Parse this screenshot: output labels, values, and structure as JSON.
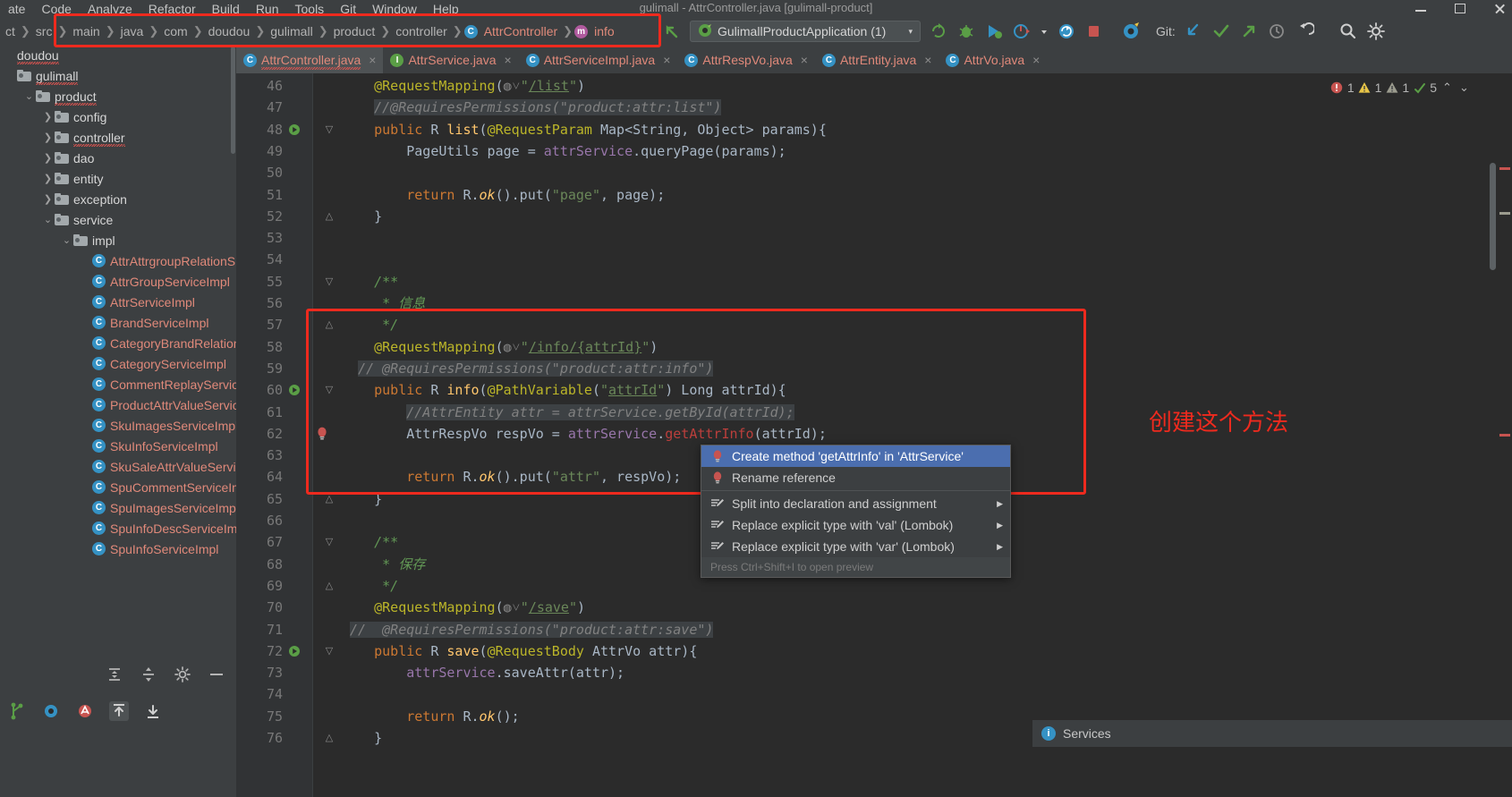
{
  "window": {
    "title": "gulimall - AttrController.java [gulimall-product]",
    "minimize_label": "minimize",
    "maximize_label": "maximize",
    "close_label": "close"
  },
  "menubar": {
    "items": [
      "ate",
      "Code",
      "Analyze",
      "Refactor",
      "Build",
      "Run",
      "Tools",
      "Git",
      "Window",
      "Help"
    ]
  },
  "navbar": {
    "crumbs": [
      {
        "label": "ct",
        "icon": null
      },
      {
        "label": "src",
        "icon": null
      },
      {
        "label": "main",
        "icon": null
      },
      {
        "label": "java",
        "icon": null
      },
      {
        "label": "com",
        "icon": null
      },
      {
        "label": "doudou",
        "icon": null
      },
      {
        "label": "gulimall",
        "icon": null
      },
      {
        "label": "product",
        "icon": null
      },
      {
        "label": "controller",
        "icon": null
      },
      {
        "label": "AttrController",
        "icon": "class-icon"
      },
      {
        "label": "info",
        "icon": "method-icon"
      }
    ]
  },
  "toolbar": {
    "back_icon": "back-arrow-icon",
    "run_config": "GulimallProductApplication (1)",
    "run_config_icon": "spring-boot-icon",
    "dropdown_arrow": "▾",
    "buttons": [
      {
        "name": "rerun-icon",
        "glyph": "⟳"
      },
      {
        "name": "debug-icon",
        "glyph": "🐞"
      },
      {
        "name": "run-with-coverage-icon",
        "glyph": "▶"
      },
      {
        "name": "profiler-icon",
        "glyph": "◔"
      },
      {
        "name": "profiler-dropdown-icon",
        "glyph": "▾"
      },
      {
        "name": "update-app-icon",
        "glyph": "↻"
      },
      {
        "name": "stop-icon",
        "glyph": "■"
      },
      {
        "name": "spring-icon",
        "glyph": "❧"
      }
    ],
    "git_label": "Git:",
    "git_buttons": [
      {
        "name": "git-update-project-icon",
        "glyph": "↙"
      },
      {
        "name": "git-commit-icon",
        "glyph": "✓"
      },
      {
        "name": "git-push-icon",
        "glyph": "↗"
      },
      {
        "name": "git-history-icon",
        "glyph": "◷"
      },
      {
        "name": "git-rollback-icon",
        "glyph": "↺"
      }
    ],
    "extra_buttons": [
      {
        "name": "search-everywhere-icon",
        "glyph": "⌕"
      },
      {
        "name": "settings-icon",
        "glyph": "⚙"
      }
    ]
  },
  "sidebar": {
    "toolbar_icons": [
      "locate-icon",
      "expand-all-icon",
      "collapse-all-icon",
      "settings-icon",
      "hide-icon"
    ],
    "tree": [
      {
        "label": "doudou",
        "indent": 0,
        "twisty": "",
        "icon": "none",
        "squiggle": true,
        "red": false
      },
      {
        "label": "gulimall",
        "indent": 0,
        "twisty": "",
        "icon": "folder",
        "squiggle": true,
        "red": false
      },
      {
        "label": "product",
        "indent": 1,
        "twisty": "v",
        "icon": "folder",
        "squiggle": true,
        "red": false
      },
      {
        "label": "config",
        "indent": 2,
        "twisty": ">",
        "icon": "folder",
        "squiggle": false,
        "red": false
      },
      {
        "label": "controller",
        "indent": 2,
        "twisty": ">",
        "icon": "folder",
        "squiggle": true,
        "red": false
      },
      {
        "label": "dao",
        "indent": 2,
        "twisty": ">",
        "icon": "folder",
        "squiggle": false,
        "red": false
      },
      {
        "label": "entity",
        "indent": 2,
        "twisty": ">",
        "icon": "folder",
        "squiggle": false,
        "red": false
      },
      {
        "label": "exception",
        "indent": 2,
        "twisty": ">",
        "icon": "folder",
        "squiggle": false,
        "red": false
      },
      {
        "label": "service",
        "indent": 2,
        "twisty": "v",
        "icon": "folder",
        "squiggle": false,
        "red": false
      },
      {
        "label": "impl",
        "indent": 3,
        "twisty": "v",
        "icon": "folder",
        "squiggle": false,
        "red": false
      },
      {
        "label": "AttrAttrgroupRelationS",
        "indent": 4,
        "twisty": "",
        "icon": "class",
        "squiggle": false,
        "red": true
      },
      {
        "label": "AttrGroupServiceImpl",
        "indent": 4,
        "twisty": "",
        "icon": "class",
        "squiggle": false,
        "red": true
      },
      {
        "label": "AttrServiceImpl",
        "indent": 4,
        "twisty": "",
        "icon": "class",
        "squiggle": false,
        "red": true
      },
      {
        "label": "BrandServiceImpl",
        "indent": 4,
        "twisty": "",
        "icon": "class",
        "squiggle": false,
        "red": true
      },
      {
        "label": "CategoryBrandRelations",
        "indent": 4,
        "twisty": "",
        "icon": "class",
        "squiggle": false,
        "red": true
      },
      {
        "label": "CategoryServiceImpl",
        "indent": 4,
        "twisty": "",
        "icon": "class",
        "squiggle": false,
        "red": true
      },
      {
        "label": "CommentReplayService",
        "indent": 4,
        "twisty": "",
        "icon": "class",
        "squiggle": false,
        "red": true
      },
      {
        "label": "ProductAttrValueServic",
        "indent": 4,
        "twisty": "",
        "icon": "class",
        "squiggle": false,
        "red": true
      },
      {
        "label": "SkuImagesServiceImpl",
        "indent": 4,
        "twisty": "",
        "icon": "class",
        "squiggle": false,
        "red": true
      },
      {
        "label": "SkuInfoServiceImpl",
        "indent": 4,
        "twisty": "",
        "icon": "class",
        "squiggle": false,
        "red": true
      },
      {
        "label": "SkuSaleAttrValueService",
        "indent": 4,
        "twisty": "",
        "icon": "class",
        "squiggle": false,
        "red": true
      },
      {
        "label": "SpuCommentServiceIm",
        "indent": 4,
        "twisty": "",
        "icon": "class",
        "squiggle": false,
        "red": true
      },
      {
        "label": "SpuImagesServiceImpl",
        "indent": 4,
        "twisty": "",
        "icon": "class",
        "squiggle": false,
        "red": true
      },
      {
        "label": "SpuInfoDescServiceImp",
        "indent": 4,
        "twisty": "",
        "icon": "class",
        "squiggle": false,
        "red": true
      },
      {
        "label": "SpuInfoServiceImpl",
        "indent": 4,
        "twisty": "",
        "icon": "class",
        "squiggle": false,
        "red": true
      }
    ],
    "bottom_icons": [
      "branch-icon",
      "structure-icon",
      "analyze-icon",
      "step-out-icon",
      "step-into-icon"
    ]
  },
  "editor": {
    "tabs": [
      {
        "label": "AttrController.java",
        "icon": "class-icon",
        "active": true,
        "close": "×"
      },
      {
        "label": "AttrService.java",
        "icon": "interface-icon",
        "active": false,
        "close": "×"
      },
      {
        "label": "AttrServiceImpl.java",
        "icon": "class-icon",
        "active": false,
        "close": "×"
      },
      {
        "label": "AttrRespVo.java",
        "icon": "class-icon",
        "active": false,
        "close": "×"
      },
      {
        "label": "AttrEntity.java",
        "icon": "class-icon",
        "active": false,
        "close": "×"
      },
      {
        "label": "AttrVo.java",
        "icon": "class-icon",
        "active": false,
        "close": "×"
      }
    ],
    "inspections": {
      "error_count": "1",
      "warning_count": "1",
      "weak_warning_count": "1",
      "typo_count": "5",
      "up_arrow": "⌃",
      "down_arrow": "⌄"
    },
    "first_line_number": 46,
    "lines": [
      {
        "n": 46,
        "html": "    <span class='anno'>@RequestMapping</span>(<span class='cmt'>◍˅</span><span class='str'>\"</span><span class='link-u'>/list</span><span class='str'>\"</span>)",
        "run": false,
        "fold": "",
        "bulb": false
      },
      {
        "n": 47,
        "html": "    <span class='cmt-hl'>//@RequiresPermissions(\"product:attr:list\")</span>",
        "run": false,
        "fold": "",
        "bulb": false
      },
      {
        "n": 48,
        "html": "    <span class='kw'>public</span> R <span class='mth'>list</span>(<span class='anno'>@RequestParam</span> Map&lt;String, Object&gt; params){",
        "run": true,
        "fold": "▽",
        "bulb": false
      },
      {
        "n": 49,
        "html": "        PageUtils page = <span class='fld'>attrService</span>.queryPage(params);",
        "run": false,
        "fold": "",
        "bulb": false
      },
      {
        "n": 50,
        "html": "",
        "run": false,
        "fold": "",
        "bulb": false
      },
      {
        "n": 51,
        "html": "        <span class='kw'>return</span> R.<span class='mth ital'>ok</span>().put(<span class='str'>\"page\"</span>, page);",
        "run": false,
        "fold": "",
        "bulb": false
      },
      {
        "n": 52,
        "html": "    }",
        "run": false,
        "fold": "△",
        "bulb": false
      },
      {
        "n": 53,
        "html": "",
        "run": false,
        "fold": "",
        "bulb": false
      },
      {
        "n": 54,
        "html": "",
        "run": false,
        "fold": "",
        "bulb": false
      },
      {
        "n": 55,
        "html": "    <span class='jdoc'>/**</span>",
        "run": false,
        "fold": "▽",
        "bulb": false
      },
      {
        "n": 56,
        "html": "     <span class='jdoc'>* 信息</span>",
        "run": false,
        "fold": "",
        "bulb": false
      },
      {
        "n": 57,
        "html": "     <span class='jdoc'>*/</span>",
        "run": false,
        "fold": "△",
        "bulb": false
      },
      {
        "n": 58,
        "html": "    <span class='anno'>@RequestMapping</span>(<span class='cmt'>◍˅</span><span class='str'>\"</span><span class='link-u'>/info/{attrId}</span><span class='str'>\"</span>)",
        "run": false,
        "fold": "",
        "bulb": false
      },
      {
        "n": 59,
        "html": "  <span class='cmt-hl'>// @RequiresPermissions(\"product:attr:info\")</span>",
        "run": false,
        "fold": "",
        "bulb": false
      },
      {
        "n": 60,
        "html": "    <span class='kw'>public</span> R <span class='mth'>info</span>(<span class='anno'>@PathVariable</span>(<span class='str'>\"</span><span class='id-u'>attrId</span><span class='str'>\"</span>) Long attrId){",
        "run": true,
        "fold": "▽",
        "bulb": false
      },
      {
        "n": 61,
        "html": "        <span class='cmt-hl'>//AttrEntity attr = attrService.getById(attrId);</span>",
        "run": false,
        "fold": "",
        "bulb": false
      },
      {
        "n": 62,
        "html": "        AttrRespVo respVo = <span class='fld'>attrService</span>.<span class='err-underline'>getAttrInfo</span>(attrId);",
        "run": false,
        "fold": "",
        "bulb": true
      },
      {
        "n": 63,
        "html": "",
        "run": false,
        "fold": "",
        "bulb": false
      },
      {
        "n": 64,
        "html": "        <span class='kw'>return</span> R.<span class='mth ital'>ok</span>().put(<span class='str'>\"attr\"</span>, respVo);",
        "run": false,
        "fold": "",
        "bulb": false
      },
      {
        "n": 65,
        "html": "    }",
        "run": false,
        "fold": "△",
        "bulb": false
      },
      {
        "n": 66,
        "html": "",
        "run": false,
        "fold": "",
        "bulb": false
      },
      {
        "n": 67,
        "html": "    <span class='jdoc'>/**</span>",
        "run": false,
        "fold": "▽",
        "bulb": false
      },
      {
        "n": 68,
        "html": "     <span class='jdoc'>* 保存</span>",
        "run": false,
        "fold": "",
        "bulb": false
      },
      {
        "n": 69,
        "html": "     <span class='jdoc'>*/</span>",
        "run": false,
        "fold": "△",
        "bulb": false
      },
      {
        "n": 70,
        "html": "    <span class='anno'>@RequestMapping</span>(<span class='cmt'>◍˅</span><span class='str'>\"</span><span class='link-u'>/save</span><span class='str'>\"</span>)",
        "run": false,
        "fold": "",
        "bulb": false
      },
      {
        "n": 71,
        "html": " <span class='cmt-hl'>//  @RequiresPermissions(\"product:attr:save\")</span>",
        "run": false,
        "fold": "",
        "bulb": false
      },
      {
        "n": 72,
        "html": "    <span class='kw'>public</span> R <span class='mth'>save</span>(<span class='anno'>@RequestBody</span> AttrVo attr){",
        "run": true,
        "fold": "▽",
        "bulb": false
      },
      {
        "n": 73,
        "html": "        <span class='fld'>attrService</span>.saveAttr(attr);",
        "run": false,
        "fold": "",
        "bulb": false
      },
      {
        "n": 74,
        "html": "",
        "run": false,
        "fold": "",
        "bulb": false
      },
      {
        "n": 75,
        "html": "        <span class='kw'>return</span> R.<span class='mth ital'>ok</span>();",
        "run": false,
        "fold": "",
        "bulb": false
      },
      {
        "n": 76,
        "html": "    }",
        "run": false,
        "fold": "△",
        "bulb": false
      }
    ]
  },
  "intention_popup": {
    "items": [
      {
        "label": "Create method 'getAttrInfo' in 'AttrService'",
        "icon": "error-bulb-icon",
        "selected": true,
        "submenu": false
      },
      {
        "label": "Rename reference",
        "icon": "error-bulb-icon",
        "selected": false,
        "submenu": false
      },
      {
        "label": "Split into declaration and assignment",
        "icon": "intention-icon",
        "selected": false,
        "submenu": true
      },
      {
        "label": "Replace explicit type with 'val' (Lombok)",
        "icon": "intention-icon",
        "selected": false,
        "submenu": true
      },
      {
        "label": "Replace explicit type with 'var' (Lombok)",
        "icon": "intention-icon",
        "selected": false,
        "submenu": true
      }
    ],
    "hint": "Press Ctrl+Shift+I to open preview"
  },
  "annotations": {
    "note_text": "创建这个方法",
    "box_color": "#ee2a1e"
  },
  "services": {
    "label": "Services",
    "icon": "info-icon"
  },
  "colors": {
    "accent_blue": "#4b6eaf",
    "annotation_red": "#ee2a1e",
    "editor_bg": "#2b2b2b",
    "ui_bg": "#3c3f41",
    "class_icon": "#3592c4",
    "interface_icon": "#5a9e46"
  }
}
